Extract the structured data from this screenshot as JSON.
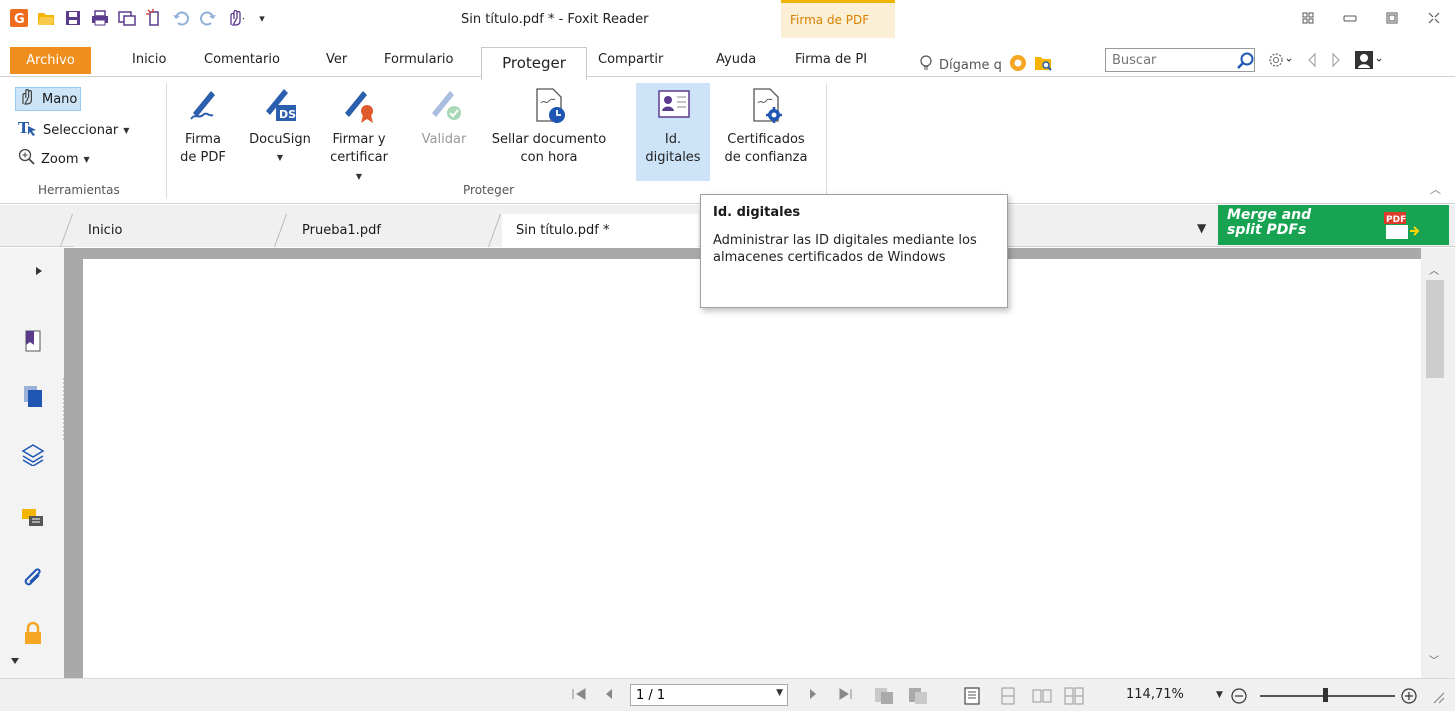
{
  "window": {
    "title": "Sin título.pdf * - Foxit Reader",
    "context_tab_title": "Firma de PDF"
  },
  "ribbon_tabs": {
    "file": "Archivo",
    "home": "Inicio",
    "comment": "Comentario",
    "view": "Ver",
    "form": "Formulario",
    "protect": "Proteger",
    "share": "Compartir",
    "help": "Ayuda",
    "pdf_sign": "Firma de PI"
  },
  "tell_me": "Dígame q",
  "search": {
    "placeholder": "Buscar"
  },
  "tools_group": {
    "label": "Herramientas",
    "hand": "Mano",
    "select": "Seleccionar",
    "zoom": "Zoom"
  },
  "protect_group": {
    "label": "Proteger",
    "pdf_sign_l1": "Firma",
    "pdf_sign_l2": "de PDF",
    "docusign": "DocuSign",
    "sign_certify_l1": "Firmar y",
    "sign_certify_l2": "certificar",
    "validate": "Validar",
    "timestamp_l1": "Sellar documento",
    "timestamp_l2": "con hora",
    "digital_ids_l1": "Id.",
    "digital_ids_l2": "digitales",
    "trusted_certs_l1": "Certificados",
    "trusted_certs_l2": "de confianza"
  },
  "tooltip": {
    "title": "Id. digitales",
    "body": "Administrar las ID digitales mediante los almacenes certificados de Windows"
  },
  "doc_tabs": [
    "Inicio",
    "Prueba1.pdf",
    "Sin título.pdf *"
  ],
  "ad": {
    "line1": "Merge and",
    "line2": "split PDFs"
  },
  "status": {
    "page": "1 / 1",
    "zoom": "114,71%"
  },
  "colors": {
    "file_tab": "#ef8d1d",
    "context_tab": "#d88000",
    "selection": "#cde4f8",
    "ad_green": "#18a353"
  }
}
